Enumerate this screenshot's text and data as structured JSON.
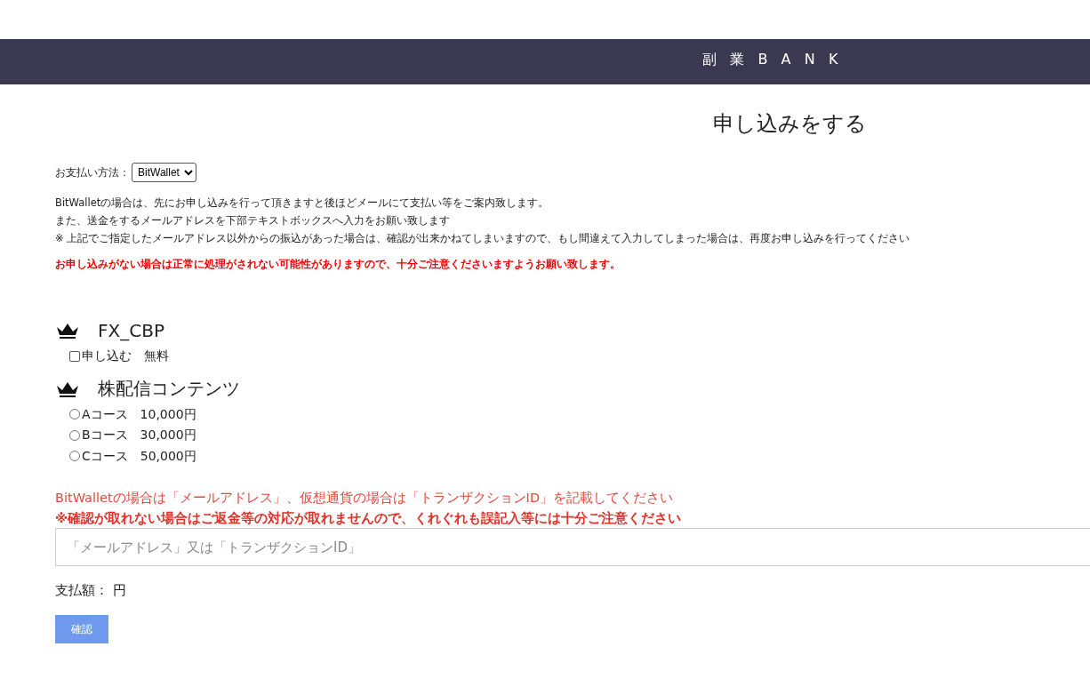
{
  "header": {
    "title": "副業BANK"
  },
  "page_title": "申し込みをする",
  "payment": {
    "label": "お支払い方法：",
    "value": "BitWallet"
  },
  "notes": [
    "BitWalletの場合は、先にお申し込みを行って頂きますと後ほどメールにて支払い等をご案内致します。",
    "また、送金をするメールアドレスを下部テキストボックスへ入力をお願い致します",
    "※ 上記でご指定したメールアドレス以外からの振込があった場合は、確認が出来かねてしまいますので、もし間違えて入力してしまった場合は、再度お申し込みを行ってください"
  ],
  "warning": "お申し込みがない場合は正常に処理がされない可能性がありますので、十分ご注意くださいますようお願い致します。",
  "products": [
    {
      "name": "FX_CBP",
      "options": [
        {
          "kind": "checkbox",
          "label": "申し込む　無料",
          "checked": false
        }
      ]
    },
    {
      "name": "株配信コンテンツ",
      "options": [
        {
          "kind": "radio",
          "label": "Aコース　10,000円",
          "selected": false
        },
        {
          "kind": "radio",
          "label": "Bコース　30,000円",
          "selected": false
        },
        {
          "kind": "radio",
          "label": "Cコース　50,000円",
          "selected": false
        }
      ]
    }
  ],
  "instructions": "BitWalletの場合は「メールアドレス」、仮想通貨の場合は「トランザクションID」を記載してください",
  "caution": "※確認が取れない場合はご返金等の対応が取れませんので、くれぐれも誤記入等には十分ご注意ください",
  "id_field": {
    "placeholder": "「メールアドレス」又は「トランザクションID」"
  },
  "total": "支払額： 円",
  "submit": "確認"
}
